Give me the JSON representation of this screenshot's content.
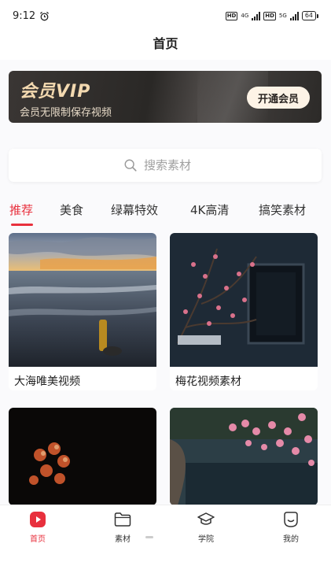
{
  "status_bar": {
    "time": "9:12",
    "network_left": "HD",
    "network_left_type": "4G",
    "network_right": "HD",
    "network_right_type": "5G",
    "battery": "64",
    "alarm_icon": "alarm-clock-icon"
  },
  "header": {
    "title": "首页"
  },
  "vip_banner": {
    "title": "会员VIP",
    "subtitle": "会员无限制保存视频",
    "button_label": "开通会员",
    "title_color": "#f3d9b0"
  },
  "search": {
    "placeholder": "搜索素材",
    "icon": "search-icon"
  },
  "tabs": [
    {
      "label": "推荐",
      "active": true
    },
    {
      "label": "美食",
      "active": false
    },
    {
      "label": "绿幕特效",
      "active": false
    },
    {
      "label": "4K高清",
      "active": false
    },
    {
      "label": "搞笑素材",
      "active": false
    }
  ],
  "cards": [
    {
      "caption": "大海唯美视频"
    },
    {
      "caption": "梅花视频素材"
    },
    {
      "caption": ""
    },
    {
      "caption": ""
    }
  ],
  "bottom_nav": [
    {
      "label": "首页",
      "icon": "home-play-icon",
      "active": true
    },
    {
      "label": "素材",
      "icon": "folder-icon",
      "active": false
    },
    {
      "label": "学院",
      "icon": "graduation-cap-icon",
      "active": false
    },
    {
      "label": "我的",
      "icon": "profile-smile-icon",
      "active": false
    }
  ],
  "colors": {
    "accent": "#e8303d",
    "vip_dark": "#2a2826",
    "vip_gold": "#f3d9b0"
  }
}
